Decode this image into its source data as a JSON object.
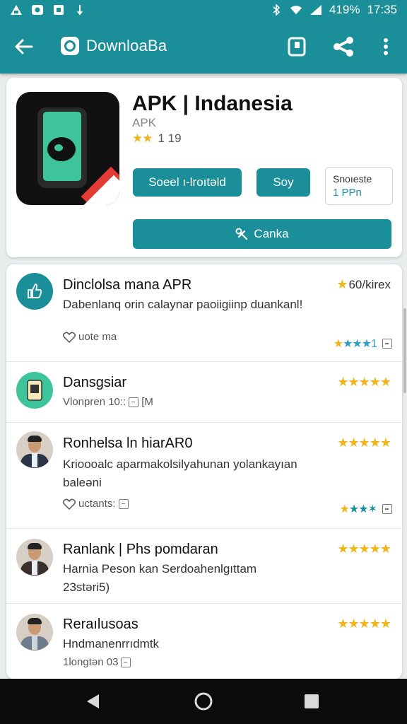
{
  "status_bar": {
    "battery": "419%",
    "time": "17:35"
  },
  "app_bar": {
    "title": "DownloaBa"
  },
  "app": {
    "name": "APK | Indanesia",
    "subtitle": "APK",
    "stars": "★★",
    "rating": "1 19",
    "btn_primary": "Soeel ı-lroıtəld",
    "btn_secondary": "Soy",
    "outline_line1": "Snoıeste",
    "outline_line2": "1 PPn",
    "main_button": "Canka"
  },
  "reviews": [
    {
      "title": "Dinclolsa mana APR",
      "desc": "Dabenlanq orin calaynar paoiigiinp duankanl!",
      "meta": "uote ma",
      "rating_stars": "★",
      "rating_count": "60/kirex",
      "small_stars": "★★★1"
    },
    {
      "title": "Dansgsiar",
      "meta": "Vlonpren 10:: ",
      "meta_icon": "[M",
      "rating_stars": "★★★★★"
    },
    {
      "title": "Ronhelsa ln hiarAR0",
      "desc": "Krioooalc aparmakolsilyahunan yolankayıan baleəni",
      "meta": "uctants:",
      "rating_stars": "★★★★★",
      "small_stars": "★★✶"
    },
    {
      "title": "Ranlank | Phs pomdaran",
      "desc": "Harnia Peson kan Serdoahenlgıttam 23stəri5)",
      "rating_stars": "★★★★★"
    },
    {
      "title": "Reraılusoas",
      "desc": "Hndmanenrrıdmtk",
      "meta": "1longtən 03",
      "rating_stars": "★★★★★"
    }
  ],
  "colors": {
    "primary": "#1a8e99",
    "star": "#f0b41c",
    "accent_red": "#e23a34"
  }
}
